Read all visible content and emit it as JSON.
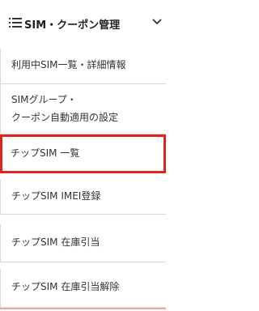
{
  "header": {
    "title": "SIM・クーポン管理",
    "icon": "list-icon",
    "expand_icon": "chevron-down-icon"
  },
  "items": [
    {
      "line1": "利用中SIM一覧・詳細情報",
      "line2": ""
    },
    {
      "line1": "SIMグループ・",
      "line2": "クーポン自動適用の設定"
    },
    {
      "line1": "チップSIM 一覧",
      "line2": "",
      "active": true
    },
    {
      "line1": "チップSIM IMEI登録",
      "line2": ""
    },
    {
      "line1": "チップSIM 在庫引当",
      "line2": ""
    },
    {
      "line1": "チップSIM 在庫引当解除",
      "line2": ""
    }
  ],
  "colors": {
    "active_border": "#e2231a",
    "divider": "#d9d9d9",
    "text": "#333333"
  }
}
